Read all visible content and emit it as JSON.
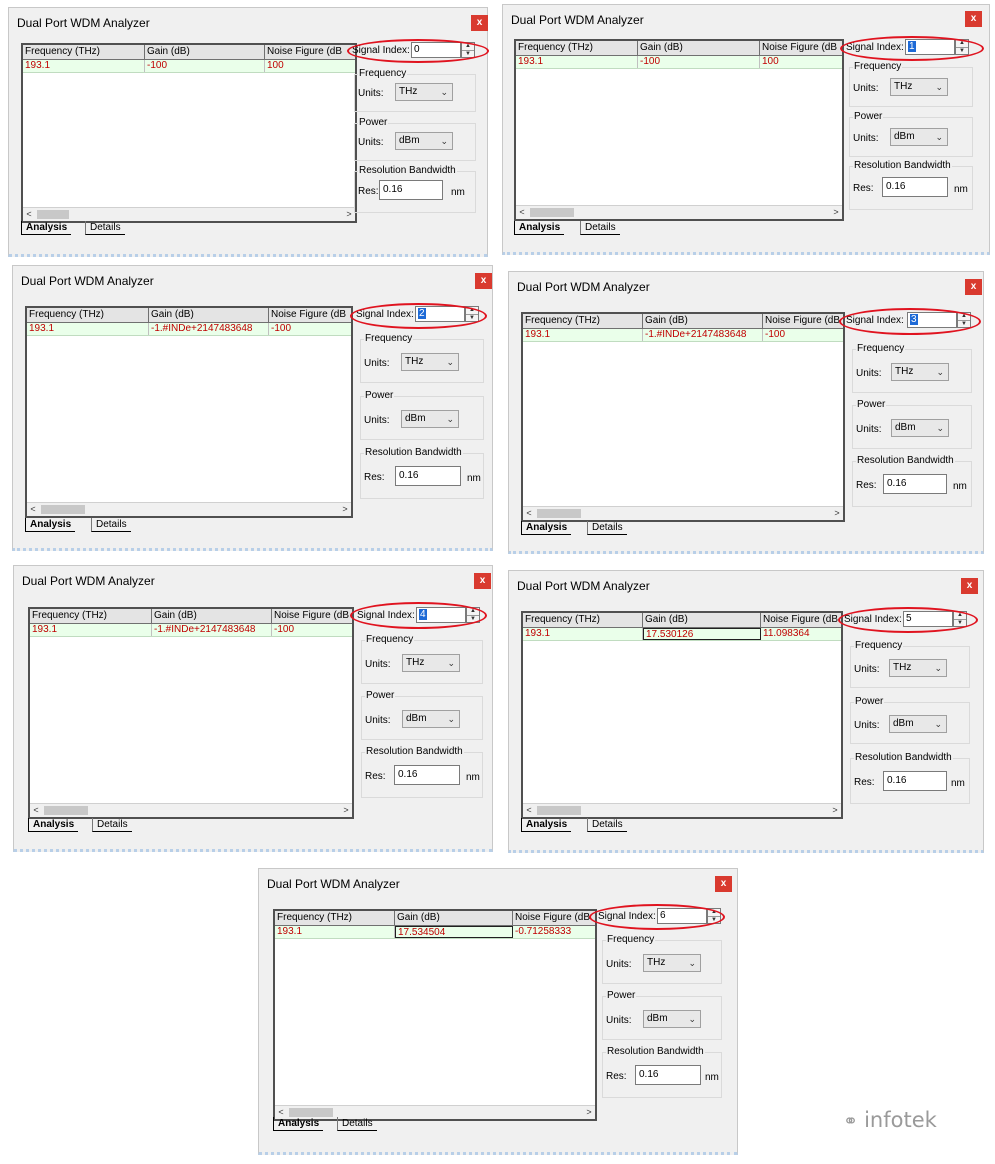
{
  "watermark": "infotek",
  "panels": [
    {
      "title": "Dual Port WDM Analyzer",
      "close": "x",
      "cols": [
        "Frequency (THz)",
        "Gain (dB)",
        "Noise Figure (dB"
      ],
      "row": [
        "193.1",
        "-100",
        "100"
      ],
      "signal_label": "Signal Index:",
      "signal_index": "0",
      "frequency_group": "Frequency",
      "power_group": "Power",
      "resolution_group": "Resolution Bandwidth",
      "units_label": "Units:",
      "freq_units": "THz",
      "power_units": "dBm",
      "res_label": "Res:",
      "res_value": "0.16",
      "res_unit": "nm",
      "tab_analysis": "Analysis",
      "tab_details": "Details"
    },
    {
      "title": "Dual Port WDM Analyzer",
      "close": "x",
      "cols": [
        "Frequency (THz)",
        "Gain (dB)",
        "Noise Figure (dB"
      ],
      "row": [
        "193.1",
        "-100",
        "100"
      ],
      "signal_label": "Signal Index:",
      "signal_index": "1",
      "frequency_group": "Frequency",
      "power_group": "Power",
      "resolution_group": "Resolution Bandwidth",
      "units_label": "Units:",
      "freq_units": "THz",
      "power_units": "dBm",
      "res_label": "Res:",
      "res_value": "0.16",
      "res_unit": "nm",
      "tab_analysis": "Analysis",
      "tab_details": "Details"
    },
    {
      "title": "Dual Port WDM Analyzer",
      "close": "x",
      "cols": [
        "Frequency (THz)",
        "Gain (dB)",
        "Noise Figure (dB"
      ],
      "row": [
        "193.1",
        "-1.#INDe+2147483648",
        "-100"
      ],
      "signal_label": "Signal Index:",
      "signal_index": "2",
      "frequency_group": "Frequency",
      "power_group": "Power",
      "resolution_group": "Resolution Bandwidth",
      "units_label": "Units:",
      "freq_units": "THz",
      "power_units": "dBm",
      "res_label": "Res:",
      "res_value": "0.16",
      "res_unit": "nm",
      "tab_analysis": "Analysis",
      "tab_details": "Details"
    },
    {
      "title": "Dual Port WDM Analyzer",
      "close": "x",
      "cols": [
        "Frequency (THz)",
        "Gain (dB)",
        "Noise Figure (dB"
      ],
      "row": [
        "193.1",
        "-1.#INDe+2147483648",
        "-100"
      ],
      "signal_label": "Signal Index:",
      "signal_index": "3",
      "frequency_group": "Frequency",
      "power_group": "Power",
      "resolution_group": "Resolution Bandwidth",
      "units_label": "Units:",
      "freq_units": "THz",
      "power_units": "dBm",
      "res_label": "Res:",
      "res_value": "0.16",
      "res_unit": "nm",
      "tab_analysis": "Analysis",
      "tab_details": "Details"
    },
    {
      "title": "Dual Port WDM Analyzer",
      "close": "x",
      "cols": [
        "Frequency (THz)",
        "Gain (dB)",
        "Noise Figure (dB"
      ],
      "row": [
        "193.1",
        "-1.#INDe+2147483648",
        "-100"
      ],
      "signal_label": "Signal Index:",
      "signal_index": "4",
      "frequency_group": "Frequency",
      "power_group": "Power",
      "resolution_group": "Resolution Bandwidth",
      "units_label": "Units:",
      "freq_units": "THz",
      "power_units": "dBm",
      "res_label": "Res:",
      "res_value": "0.16",
      "res_unit": "nm",
      "tab_analysis": "Analysis",
      "tab_details": "Details"
    },
    {
      "title": "Dual Port WDM Analyzer",
      "close": "x",
      "cols": [
        "Frequency (THz)",
        "Gain (dB)",
        "Noise Figure (dB"
      ],
      "row": [
        "193.1",
        "17.530126",
        "11.098364"
      ],
      "signal_label": "Signal Index:",
      "signal_index": "5",
      "frequency_group": "Frequency",
      "power_group": "Power",
      "resolution_group": "Resolution Bandwidth",
      "units_label": "Units:",
      "freq_units": "THz",
      "power_units": "dBm",
      "res_label": "Res:",
      "res_value": "0.16",
      "res_unit": "nm",
      "tab_analysis": "Analysis",
      "tab_details": "Details"
    },
    {
      "title": "Dual Port WDM Analyzer",
      "close": "x",
      "cols": [
        "Frequency (THz)",
        "Gain (dB)",
        "Noise Figure (dB"
      ],
      "row": [
        "193.1",
        "17.534504",
        "-0.71258333"
      ],
      "signal_label": "Signal Index:",
      "signal_index": "6",
      "frequency_group": "Frequency",
      "power_group": "Power",
      "resolution_group": "Resolution Bandwidth",
      "units_label": "Units:",
      "freq_units": "THz",
      "power_units": "dBm",
      "res_label": "Res:",
      "res_value": "0.16",
      "res_unit": "nm",
      "tab_analysis": "Analysis",
      "tab_details": "Details"
    }
  ]
}
